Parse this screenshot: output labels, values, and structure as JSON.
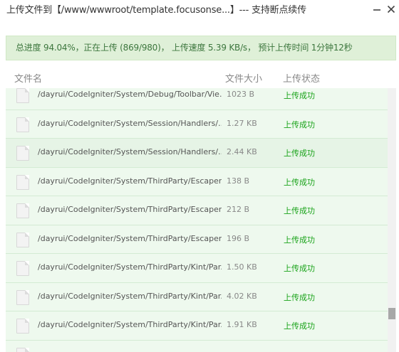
{
  "dialog": {
    "title": "上传文件到【/www/wwwroot/template.focusonse...】--- 支持断点续传"
  },
  "progress": {
    "text": "总进度 94.04%，正在上传 (869/980)，  上传速度 5.39 KB/s，    预计上传时间 1分钟12秒"
  },
  "table": {
    "columns": [
      "文件名",
      "文件大小",
      "上传状态"
    ],
    "rows": [
      {
        "name": "/dayrui/CodeIgniter/System/Debug/Toolbar/Vie...",
        "size": "1023 B",
        "status": "上传成功"
      },
      {
        "name": "/dayrui/CodeIgniter/System/Session/Handlers/...",
        "size": "1.27 KB",
        "status": "上传成功"
      },
      {
        "name": "/dayrui/CodeIgniter/System/Session/Handlers/...",
        "size": "2.44 KB",
        "status": "上传成功"
      },
      {
        "name": "/dayrui/CodeIgniter/System/ThirdParty/Escaper...",
        "size": "138 B",
        "status": "上传成功"
      },
      {
        "name": "/dayrui/CodeIgniter/System/ThirdParty/Escaper...",
        "size": "212 B",
        "status": "上传成功"
      },
      {
        "name": "/dayrui/CodeIgniter/System/ThirdParty/Escaper...",
        "size": "196 B",
        "status": "上传成功"
      },
      {
        "name": "/dayrui/CodeIgniter/System/ThirdParty/Kint/Par...",
        "size": "1.50 KB",
        "status": "上传成功"
      },
      {
        "name": "/dayrui/CodeIgniter/System/ThirdParty/Kint/Par...",
        "size": "4.02 KB",
        "status": "上传成功"
      },
      {
        "name": "/dayrui/CodeIgniter/System/ThirdParty/Kint/Par...",
        "size": "1.91 KB",
        "status": "上传成功"
      },
      {
        "name": "",
        "size": "",
        "status": ""
      }
    ]
  },
  "icons": {
    "minimize": "minimize-icon",
    "close": "close-icon",
    "file": "file-icon"
  },
  "colors": {
    "banner_bg": "#dff0d8",
    "banner_text": "#3c763d",
    "row_bg": "#eef9ee",
    "success_text": "#19a319"
  }
}
